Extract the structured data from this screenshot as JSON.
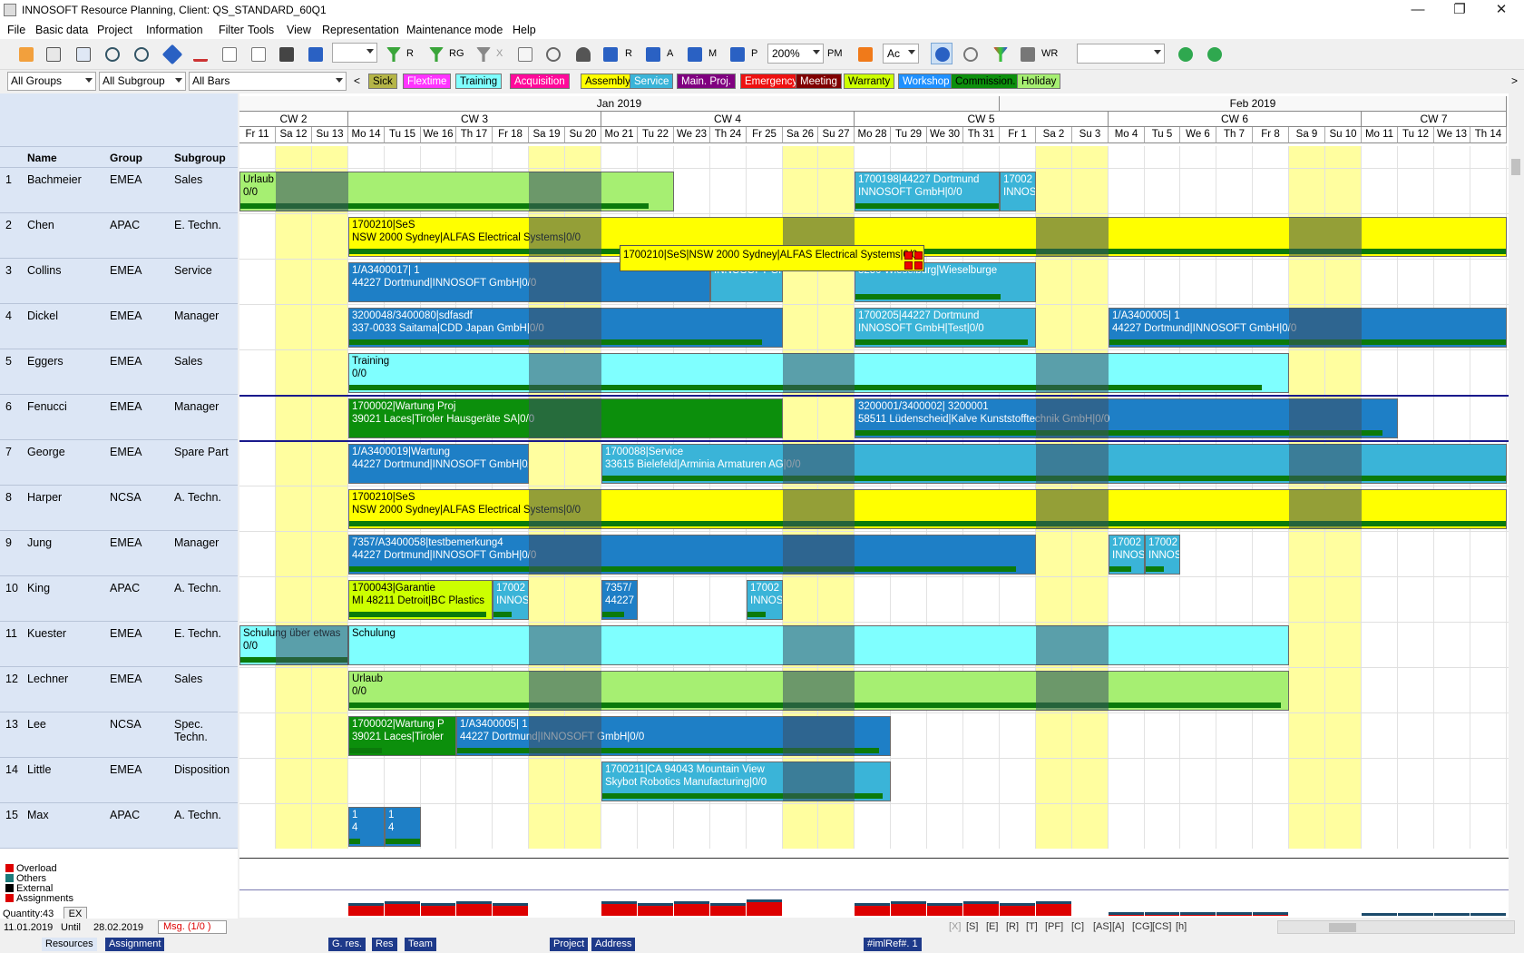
{
  "window": {
    "title": "INNOSOFT Resource Planning, Client: QS_STANDARD_60Q1",
    "minimize": "—",
    "maximize": "❐",
    "close": "✕"
  },
  "menu": [
    "File",
    "Basic data",
    "Project",
    "Information",
    "Filter",
    "Tools",
    "View",
    "Representation",
    "Maintenance mode",
    "Help"
  ],
  "toolbar": {
    "btn_r": "R",
    "btn_rg": "RG",
    "btn_x": "X",
    "btn_r2": "R",
    "btn_a": "A",
    "btn_m": "M",
    "btn_p": "P",
    "zoom": "200%",
    "pm": "PM",
    "ac": "Ac",
    "wr": "WR"
  },
  "filters": {
    "groups": "All Groups",
    "subgroup": "All Subgroup",
    "bars": "All Bars"
  },
  "legend": [
    {
      "label": "Sick",
      "bg": "#b5b547",
      "fg": "#000"
    },
    {
      "label": "Flextime",
      "bg": "#ff33ff",
      "fg": "#fff"
    },
    {
      "label": "Training",
      "bg": "#7fffff",
      "fg": "#000"
    },
    {
      "label": "Acquisition",
      "bg": "#ff0a9a",
      "fg": "#fff"
    },
    {
      "label": "Assembly",
      "bg": "#ffff00",
      "fg": "#000"
    },
    {
      "label": "Service",
      "bg": "#3ab4d8",
      "fg": "#fff"
    },
    {
      "label": "Main. Proj.",
      "bg": "#800080",
      "fg": "#fff"
    },
    {
      "label": "Emergency",
      "bg": "#ee1111",
      "fg": "#fff"
    },
    {
      "label": "Meeting",
      "bg": "#800000",
      "fg": "#fff"
    },
    {
      "label": "Warranty",
      "bg": "#ccff00",
      "fg": "#000"
    },
    {
      "label": "Workshop",
      "bg": "#1e90ff",
      "fg": "#fff"
    },
    {
      "label": "Commission.",
      "bg": "#0c8f0c",
      "fg": "#000"
    },
    {
      "label": "Holiday",
      "bg": "#a6ef72",
      "fg": "#000"
    }
  ],
  "table_header": {
    "name": "Name",
    "group": "Group",
    "subgroup": "Subgroup"
  },
  "resources": [
    {
      "no": "1",
      "name": "Bachmeier",
      "group": "EMEA",
      "subgroup": "Sales"
    },
    {
      "no": "2",
      "name": "Chen",
      "group": "APAC",
      "subgroup": "E. Techn."
    },
    {
      "no": "3",
      "name": "Collins",
      "group": "EMEA",
      "subgroup": "Service"
    },
    {
      "no": "4",
      "name": "Dickel",
      "group": "EMEA",
      "subgroup": "Manager"
    },
    {
      "no": "5",
      "name": "Eggers",
      "group": "EMEA",
      "subgroup": "Sales"
    },
    {
      "no": "6",
      "name": "Fenucci",
      "group": "EMEA",
      "subgroup": "Manager"
    },
    {
      "no": "7",
      "name": "George",
      "group": "EMEA",
      "subgroup": "Spare Part"
    },
    {
      "no": "8",
      "name": "Harper",
      "group": "NCSA",
      "subgroup": "A. Techn."
    },
    {
      "no": "9",
      "name": "Jung",
      "group": "EMEA",
      "subgroup": "Manager"
    },
    {
      "no": "10",
      "name": "King",
      "group": "APAC",
      "subgroup": "A. Techn."
    },
    {
      "no": "11",
      "name": "Kuester",
      "group": "EMEA",
      "subgroup": "E. Techn."
    },
    {
      "no": "12",
      "name": "Lechner",
      "group": "EMEA",
      "subgroup": "Sales"
    },
    {
      "no": "13",
      "name": "Lee",
      "group": "NCSA",
      "subgroup": "Spec. Techn."
    },
    {
      "no": "14",
      "name": "Little",
      "group": "EMEA",
      "subgroup": "Disposition"
    },
    {
      "no": "15",
      "name": "Max",
      "group": "APAC",
      "subgroup": "A. Techn."
    }
  ],
  "months": [
    {
      "label": "Jan 2019",
      "start": 0,
      "span": 21
    },
    {
      "label": "Feb 2019",
      "start": 21,
      "span": 14
    }
  ],
  "calendar_weeks": [
    {
      "label": "CW 2",
      "start": 0,
      "span": 3
    },
    {
      "label": "CW 3",
      "start": 3,
      "span": 7
    },
    {
      "label": "CW 4",
      "start": 10,
      "span": 7
    },
    {
      "label": "CW 5",
      "start": 17,
      "span": 7
    },
    {
      "label": "CW 6",
      "start": 24,
      "span": 7
    },
    {
      "label": "CW 7",
      "start": 31,
      "span": 4
    }
  ],
  "days": [
    "Fr 11",
    "Sa 12",
    "Su 13",
    "Mo 14",
    "Tu 15",
    "We 16",
    "Th 17",
    "Fr 18",
    "Sa 19",
    "Su 20",
    "Mo 21",
    "Tu 22",
    "We 23",
    "Th 24",
    "Fr 25",
    "Sa 26",
    "Su 27",
    "Mo 28",
    "Tu 29",
    "We 30",
    "Th 31",
    "Fr 1",
    "Sa 2",
    "Su 3",
    "Mo 4",
    "Tu 5",
    "We 6",
    "Th 7",
    "Fr 8",
    "Sa 9",
    "Su 10",
    "Mo 11",
    "Tu 12",
    "We 13",
    "Th 14"
  ],
  "weekend_days": [
    1,
    2,
    8,
    9,
    15,
    16,
    22,
    23,
    29,
    30
  ],
  "bars": [
    {
      "row": 0,
      "start": 0,
      "end": 12,
      "color": "#a6ef72",
      "line1": "Urlaub",
      "line2": "0/0",
      "progress": 0.94
    },
    {
      "row": 0,
      "start": 17,
      "end": 21,
      "color": "#3ab4d8",
      "line1": "1700198|44227 Dortmund",
      "line2": "INNOSOFT GmbH|0/0",
      "progress": 1.0,
      "fg": "#fff"
    },
    {
      "row": 0,
      "start": 21,
      "end": 22,
      "color": "#3ab4d8",
      "line1": "17002",
      "line2": "INNOS",
      "progress": 0,
      "fg": "#fff"
    },
    {
      "row": 1,
      "start": 3,
      "end": 35,
      "color": "#ffff00",
      "line1": "1700210|SeS",
      "line2": "NSW 2000 Sydney|ALFAS Electrical Systems|0/0",
      "progress": 1.0
    },
    {
      "row": 2,
      "start": 3,
      "end": 13,
      "color": "#1e7fc6",
      "line1": "1/A3400017| 1",
      "line2": "44227 Dortmund|INNOSOFT GmbH|0/0",
      "progress": 0.0,
      "fg": "#fff"
    },
    {
      "row": 2,
      "start": 13,
      "end": 15,
      "color": "#3ab4d8",
      "line1": "",
      "line2": "INNOSOFT Gm",
      "progress": 0.0,
      "fg": "#fff"
    },
    {
      "row": 2,
      "start": 17,
      "end": 22,
      "color": "#3ab4d8",
      "line1": "",
      "line2": "3250 Wieselburg|Wieselburge",
      "progress": 0.8,
      "fg": "#fff"
    },
    {
      "row": 3,
      "start": 3,
      "end": 15,
      "color": "#1e7fc6",
      "line1": "3200048/3400080|sdfasdf",
      "line2": "337-0033 Saitama|CDD Japan GmbH|0/0",
      "progress": 0.95,
      "fg": "#fff"
    },
    {
      "row": 3,
      "start": 17,
      "end": 22,
      "color": "#3ab4d8",
      "line1": "1700205|44227 Dortmund",
      "line2": "INNOSOFT GmbH|Test|0/0",
      "progress": 0.95,
      "fg": "#fff"
    },
    {
      "row": 3,
      "start": 24,
      "end": 35,
      "color": "#1e7fc6",
      "line1": "1/A3400005| 1",
      "line2": "44227 Dortmund|INNOSOFT GmbH|0/0",
      "progress": 1.0,
      "fg": "#fff"
    },
    {
      "row": 4,
      "start": 3,
      "end": 29,
      "color": "#7fffff",
      "line1": "Training",
      "line2": "0/0",
      "progress": 0.97
    },
    {
      "row": 5,
      "start": 3,
      "end": 15,
      "color": "#0c8f0c",
      "line1": "1700002|Wartung Proj",
      "line2": "39021 Laces|Tiroler Hausgeräte SA|0/0",
      "progress": 0.0,
      "fg": "#fff"
    },
    {
      "row": 5,
      "start": 17,
      "end": 32,
      "color": "#1e7fc6",
      "line1": "3200001/3400002| 3200001",
      "line2": "58511 Lüdenscheid|Kalve Kunststofftechnik GmbH|0/0",
      "progress": 0.97,
      "fg": "#fff"
    },
    {
      "row": 6,
      "start": 3,
      "end": 8,
      "color": "#1e7fc6",
      "line1": "1/A3400019|Wartung",
      "line2": "44227 Dortmund|INNOSOFT GmbH|0/0",
      "progress": 0.0,
      "fg": "#fff"
    },
    {
      "row": 6,
      "start": 10,
      "end": 35,
      "color": "#3ab4d8",
      "line1": "1700088|Service",
      "line2": "33615 Bielefeld|Arminia Armaturen AG|0/0",
      "progress": 1.0,
      "fg": "#fff"
    },
    {
      "row": 7,
      "start": 3,
      "end": 35,
      "color": "#ffff00",
      "line1": "1700210|SeS",
      "line2": "NSW 2000 Sydney|ALFAS Electrical Systems|0/0",
      "progress": 1.0
    },
    {
      "row": 8,
      "start": 3,
      "end": 22,
      "color": "#1e7fc6",
      "line1": "7357/A3400058|testbemerkung4",
      "line2": "44227 Dortmund|INNOSOFT GmbH|0/0",
      "progress": 0.97,
      "fg": "#fff"
    },
    {
      "row": 8,
      "start": 24,
      "end": 25,
      "color": "#3ab4d8",
      "line1": "17002",
      "line2": "INNOS",
      "progress": 0.6,
      "fg": "#fff"
    },
    {
      "row": 8,
      "start": 25,
      "end": 26,
      "color": "#3ab4d8",
      "line1": "17002",
      "line2": "INNOS",
      "progress": 0.5,
      "fg": "#fff"
    },
    {
      "row": 9,
      "start": 3,
      "end": 7,
      "color": "#ccff00",
      "line1": "1700043|Garantie",
      "line2": "MI 48211 Detroit|BC Plastics",
      "progress": 0.95
    },
    {
      "row": 9,
      "start": 7,
      "end": 8,
      "color": "#3ab4d8",
      "line1": "17002",
      "line2": "INNOS",
      "progress": 0.5,
      "fg": "#fff"
    },
    {
      "row": 9,
      "start": 10,
      "end": 11,
      "color": "#1e7fc6",
      "line1": "7357/",
      "line2": "44227",
      "progress": 0.6,
      "fg": "#fff"
    },
    {
      "row": 9,
      "start": 14,
      "end": 15,
      "color": "#3ab4d8",
      "line1": "17002",
      "line2": "INNOS",
      "progress": 0.5,
      "fg": "#fff"
    },
    {
      "row": 10,
      "start": 0,
      "end": 3,
      "color": "#7fffff",
      "line1": "Schulung über etwas",
      "line2": "0/0",
      "progress": 1.0
    },
    {
      "row": 10,
      "start": 3,
      "end": 29,
      "color": "#7fffff",
      "line1": "Schulung",
      "line2": "",
      "progress": 0.0
    },
    {
      "row": 11,
      "start": 3,
      "end": 29,
      "color": "#a6ef72",
      "line1": "Urlaub",
      "line2": "0/0",
      "progress": 0.99
    },
    {
      "row": 12,
      "start": 3,
      "end": 6,
      "color": "#0c8f0c",
      "line1": "1700002|Wartung P",
      "line2": "39021 Laces|Tiroler",
      "progress": 0.3,
      "fg": "#fff"
    },
    {
      "row": 12,
      "start": 6,
      "end": 18,
      "color": "#1e7fc6",
      "line1": "1/A3400005| 1",
      "line2": "44227 Dortmund|INNOSOFT GmbH|0/0",
      "progress": 0.97,
      "fg": "#fff"
    },
    {
      "row": 13,
      "start": 10,
      "end": 18,
      "color": "#3ab4d8",
      "line1": "1700211|CA 94043 Mountain View",
      "line2": "Skybot Robotics Manufacturing|0/0",
      "progress": 0.97,
      "fg": "#fff"
    },
    {
      "row": 14,
      "start": 3,
      "end": 4,
      "color": "#1e7fc6",
      "line1": "1",
      "line2": "4",
      "progress": 0.3,
      "fg": "#fff"
    },
    {
      "row": 14,
      "start": 4,
      "end": 5,
      "color": "#1e7fc6",
      "line1": "1",
      "line2": "4",
      "progress": 0.95,
      "fg": "#fff"
    }
  ],
  "tooltip": "1700210|SeS|NSW 2000 Sydney|ALFAS Electrical Systems|0/0",
  "load_legend": [
    {
      "label": "Overload",
      "color": "#dd0000"
    },
    {
      "label": "Others",
      "color": "#1b7a7a"
    },
    {
      "label": "External",
      "color": "#000000"
    },
    {
      "label": "Assignments",
      "color": "#dd0000"
    }
  ],
  "quantity": "Quantity:43",
  "ex_button": "EX",
  "date_from": "11.01.2019",
  "until_label": "Until",
  "date_to": "28.02.2019",
  "msg": "Msg. (1/0 )",
  "status_tabs": [
    "Resources",
    "Assignment",
    "G. res.",
    "Res",
    "Team",
    "Project",
    "Address",
    "#imlRef#. 1"
  ],
  "status_codes": [
    "[X]",
    "[S]",
    "[E]",
    "[R]",
    "[T]",
    "[PF]",
    "[C]",
    "[AS]",
    "[A]",
    "[CG]",
    "[CS]",
    "[h]"
  ]
}
